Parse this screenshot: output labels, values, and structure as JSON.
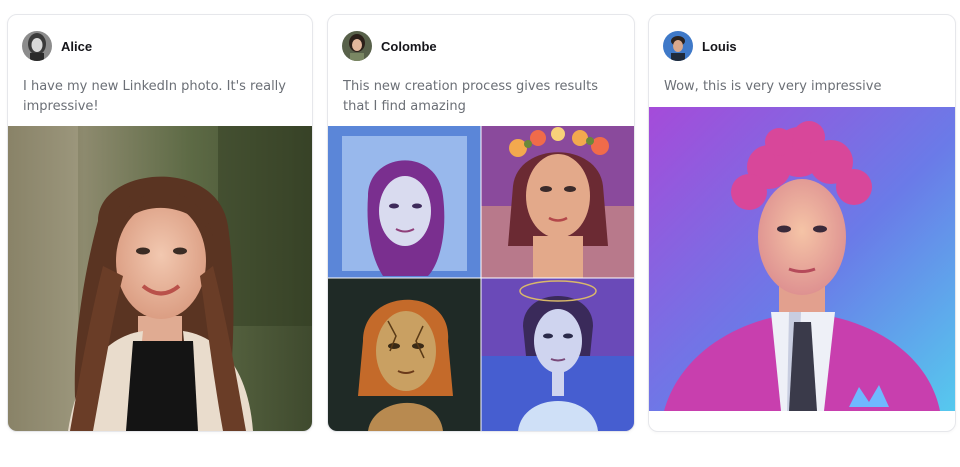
{
  "cards": [
    {
      "author": "Alice",
      "comment": "I have my new LinkedIn photo. It's really impressive!"
    },
    {
      "author": "Colombe",
      "comment": "This new creation process gives results that I find amazing"
    },
    {
      "author": "Louis",
      "comment": "Wow, this is very very impressive"
    }
  ],
  "colors": {
    "card_border": "#e6e7eb",
    "name_text": "#15151a",
    "comment_text": "#6b6f76"
  }
}
